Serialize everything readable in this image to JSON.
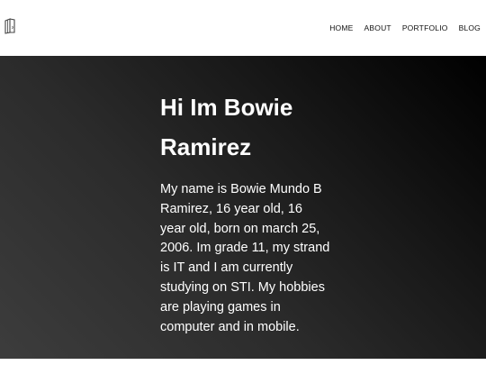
{
  "header": {
    "logo_icon": "book-logo-icon",
    "nav": [
      {
        "label": "HOME"
      },
      {
        "label": "ABOUT"
      },
      {
        "label": "PORTFOLIO"
      },
      {
        "label": "BLOG"
      }
    ]
  },
  "hero": {
    "title": "Hi Im Bowie Ramirez",
    "text": "My name is Bowie Mundo B Ramirez, 16 year old, 16 year old, born on march 25, 2006. Im grade 11, my strand is IT and I am currently studying on STI. My hobbies are playing games in computer and in mobile."
  },
  "colors": {
    "header_bg": "#ffffff",
    "hero_bg_dark": "#000000",
    "hero_bg_light": "#3d3d3d",
    "hero_text": "#ffffff",
    "nav_text": "#111111"
  }
}
